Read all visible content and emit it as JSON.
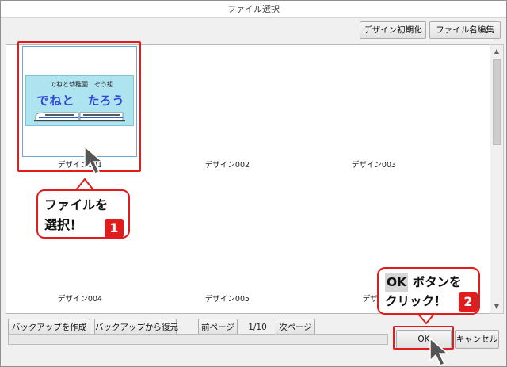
{
  "window": {
    "title": "ファイル選択"
  },
  "toolbar": {
    "reset_label": "デザイン初期化",
    "rename_label": "ファイル名編集"
  },
  "gallery": {
    "items": [
      {
        "label": "デザイン001"
      },
      {
        "label": "デザイン002"
      },
      {
        "label": "デザイン003"
      },
      {
        "label": "デザイン004"
      },
      {
        "label": "デザイン005"
      },
      {
        "label": "デザイ"
      }
    ],
    "preview": {
      "school_text": "でねと幼稚園　ぞう組",
      "name_text": "でねと　たろう"
    }
  },
  "footer": {
    "backup_label": "バックアップを作成",
    "restore_label": "バックアップから復元",
    "prev_label": "前ページ",
    "page_indicator": "1/10",
    "next_label": "次ページ",
    "ok_label": "OK",
    "cancel_label": "キャンセル"
  },
  "annotations": {
    "callout1_line1": "ファイルを",
    "callout1_line2": "選択！",
    "badge1": "1",
    "callout2_chip": "OK",
    "callout2_line1_rest": " ボタンを",
    "callout2_line2": "クリック！",
    "badge2": "2"
  },
  "colors": {
    "accent_red": "#e01c1c",
    "preview_bg": "#aee3f0",
    "name_blue": "#3146d6"
  }
}
